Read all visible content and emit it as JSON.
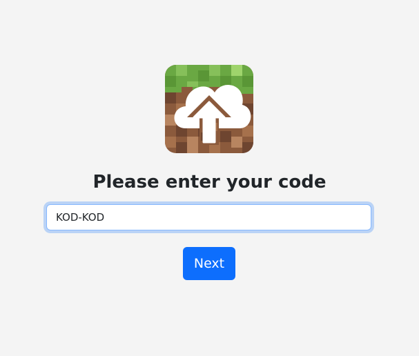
{
  "logo": {
    "icon": "minecraft-grass-block-cloud-upload-icon",
    "colors": {
      "grass": "#6aa843",
      "dirt": "#8b5a3c",
      "cloud": "#ffffff"
    }
  },
  "heading": {
    "text": "Please enter your code"
  },
  "code_input": {
    "value": "KOD-KOD",
    "placeholder": ""
  },
  "next_button": {
    "label": "Next",
    "color": "#0d6efd"
  }
}
